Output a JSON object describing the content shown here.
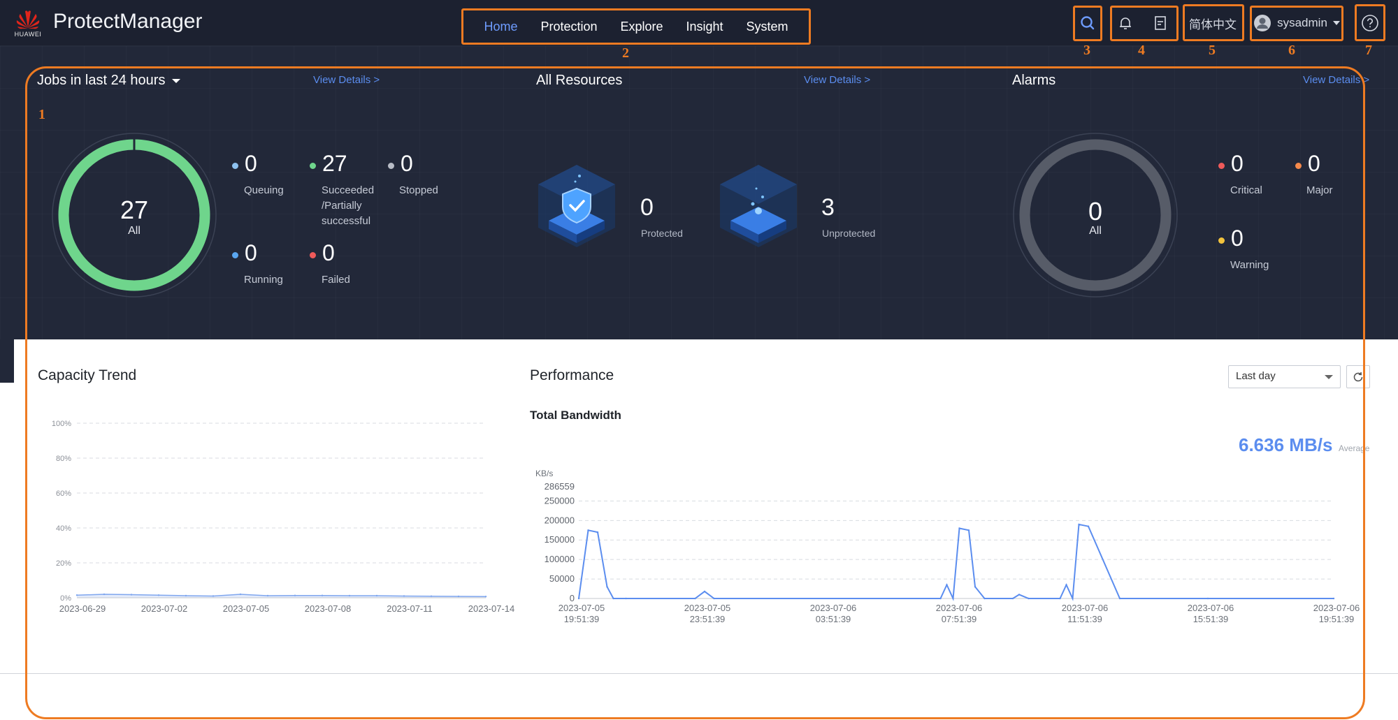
{
  "header": {
    "brand": "HUAWEI",
    "app_title": "ProtectManager",
    "nav": [
      {
        "label": "Home",
        "active": true
      },
      {
        "label": "Protection",
        "active": false
      },
      {
        "label": "Explore",
        "active": false
      },
      {
        "label": "Insight",
        "active": false
      },
      {
        "label": "System",
        "active": false
      }
    ],
    "language": "简体中文",
    "user": "sysadmin",
    "icons": [
      "search-icon",
      "bell-icon",
      "task-list-icon",
      "user-avatar-icon",
      "help-icon"
    ]
  },
  "annotations": [
    "1",
    "2",
    "3",
    "4",
    "5",
    "6",
    "7"
  ],
  "jobs": {
    "title": "Jobs in last 24 hours",
    "view_details": "View Details >",
    "total": "27",
    "total_label": "All",
    "succeeded_fraction": 1.0,
    "stats": {
      "queuing": {
        "value": "0",
        "label": "Queuing",
        "color": "#8ec2f0"
      },
      "succeeded": {
        "value": "27",
        "label_lines": [
          "Succeeded",
          "/Partially",
          "successful"
        ],
        "color": "#6fd58c"
      },
      "stopped": {
        "value": "0",
        "label": "Stopped",
        "color": "#b8bcc6"
      },
      "running": {
        "value": "0",
        "label": "Running",
        "color": "#5aa6f0"
      },
      "failed": {
        "value": "0",
        "label": "Failed",
        "color": "#ef5a5a"
      }
    }
  },
  "resources": {
    "title": "All Resources",
    "view_details": "View Details >",
    "protected": {
      "value": "0",
      "label": "Protected"
    },
    "unprotected": {
      "value": "3",
      "label": "Unprotected"
    }
  },
  "alarms": {
    "title": "Alarms",
    "view_details": "View Details >",
    "total": "0",
    "total_label": "All",
    "critical": {
      "value": "0",
      "label": "Critical",
      "color": "#ef5a5a"
    },
    "major": {
      "value": "0",
      "label": "Major",
      "color": "#f5894b"
    },
    "warning": {
      "value": "0",
      "label": "Warning",
      "color": "#f2c33d"
    }
  },
  "capacity": {
    "title": "Capacity Trend"
  },
  "performance": {
    "title": "Performance",
    "period": "Last day",
    "subtitle": "Total Bandwidth",
    "average_value": "6.636 MB/s",
    "average_label": "Average"
  },
  "chart_data": [
    {
      "type": "area",
      "title": "Capacity Trend",
      "xlabel": "",
      "ylabel": "",
      "y_ticks": [
        "100%",
        "80%",
        "60%",
        "40%",
        "20%",
        "0%"
      ],
      "ylim": [
        0,
        100
      ],
      "x_ticks": [
        "2023-06-29",
        "2023-07-02",
        "2023-07-05",
        "2023-07-08",
        "2023-07-11",
        "2023-07-14"
      ],
      "x": [
        "2023-06-29",
        "2023-06-30",
        "2023-07-01",
        "2023-07-02",
        "2023-07-03",
        "2023-07-04",
        "2023-07-05",
        "2023-07-06",
        "2023-07-07",
        "2023-07-08",
        "2023-07-09",
        "2023-07-10",
        "2023-07-11",
        "2023-07-12",
        "2023-07-13",
        "2023-07-14"
      ],
      "series": [
        {
          "values": [
            1.5,
            2,
            1.8,
            1.5,
            1.2,
            1,
            2,
            1.2,
            1.3,
            1.3,
            1.2,
            1.2,
            1,
            0.9,
            0.8,
            0.7
          ]
        }
      ],
      "grid": true
    },
    {
      "type": "line",
      "title": "Total Bandwidth",
      "ylabel": "KB/s",
      "y_ticks": [
        "286559",
        "250000",
        "200000",
        "150000",
        "100000",
        "50000",
        "0"
      ],
      "ylim": [
        0,
        286559
      ],
      "x_ticks": [
        [
          "2023-07-05",
          "19:51:39"
        ],
        [
          "2023-07-05",
          "23:51:39"
        ],
        [
          "2023-07-06",
          "03:51:39"
        ],
        [
          "2023-07-06",
          "07:51:39"
        ],
        [
          "2023-07-06",
          "11:51:39"
        ],
        [
          "2023-07-06",
          "15:51:39"
        ],
        [
          "2023-07-06",
          "19:51:39"
        ]
      ],
      "x_hours": [
        0,
        0.3,
        0.6,
        0.9,
        1.1,
        1.5,
        3.7,
        4.0,
        4.3,
        11.5,
        11.7,
        11.9,
        12.1,
        12.4,
        12.6,
        12.9,
        13.8,
        14.0,
        14.3,
        15.3,
        15.5,
        15.7,
        15.9,
        16.2,
        17.2,
        20.0,
        24.0
      ],
      "series": [
        {
          "values": [
            0,
            175000,
            170000,
            30000,
            0,
            0,
            0,
            18000,
            0,
            0,
            35000,
            0,
            180000,
            175000,
            30000,
            0,
            0,
            10000,
            0,
            0,
            35000,
            0,
            190000,
            185000,
            0,
            0,
            0
          ]
        }
      ],
      "grid": true,
      "average": "6.636 MB/s"
    }
  ]
}
